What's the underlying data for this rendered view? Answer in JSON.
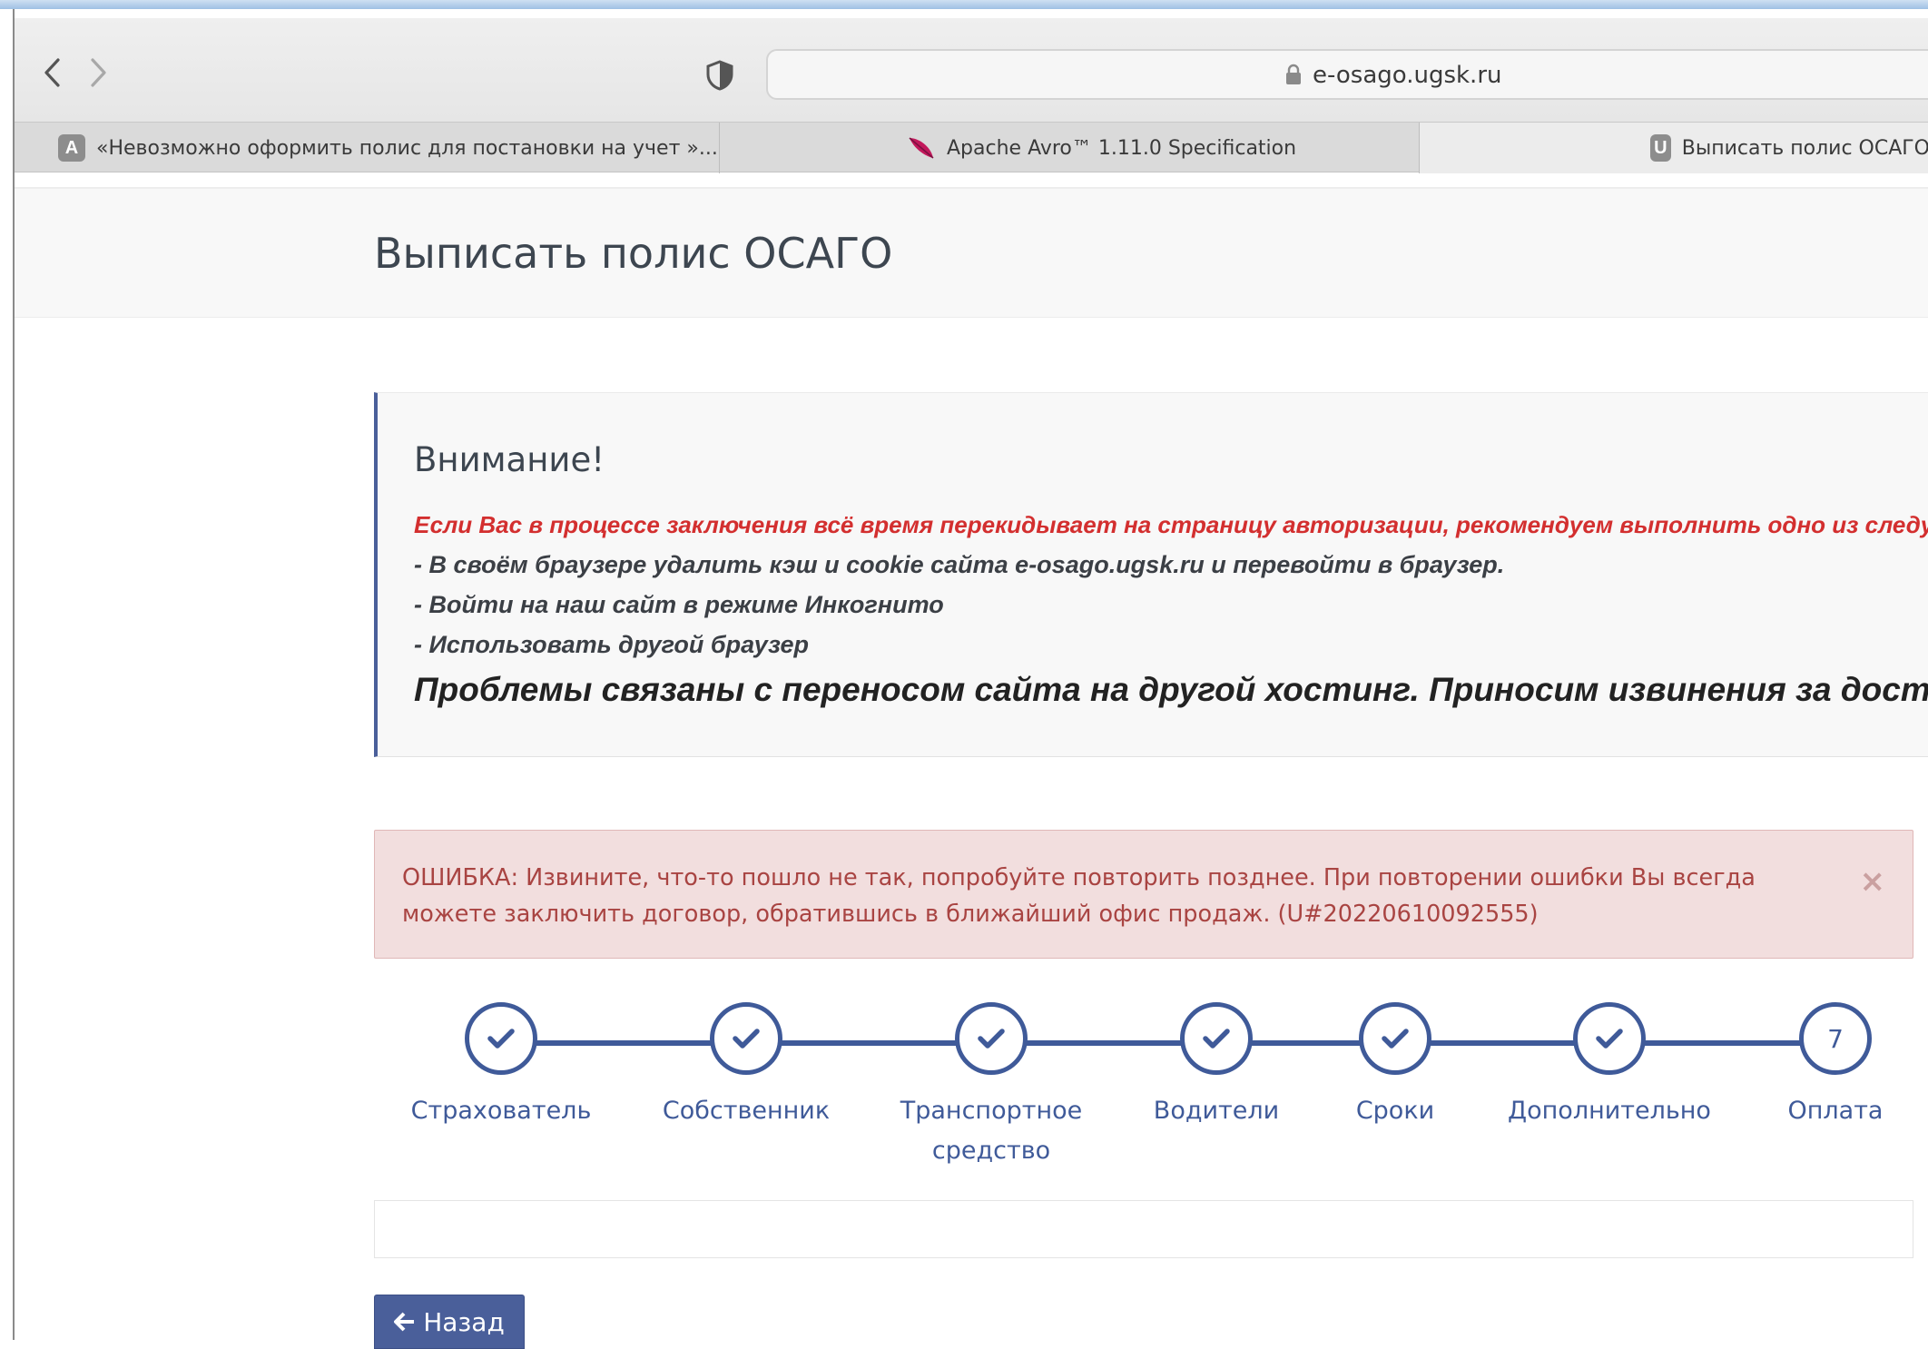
{
  "browser": {
    "url": "e-osago.ugsk.ru",
    "tabs": [
      {
        "favicon": "A",
        "title": "«Невозможно оформить полис для постановки на учет »..."
      },
      {
        "favicon": "feather-icon",
        "title": "Apache Avro™ 1.11.0 Specification"
      },
      {
        "favicon": "U",
        "title": "Выписать полис ОСАГО"
      }
    ]
  },
  "page": {
    "title": "Выписать полис ОСАГО"
  },
  "notice": {
    "heading": "Внимание!",
    "red_line": "Если Вас в процессе заключения всё время перекидывает на страницу авторизации, рекомендуем выполнить одно из следующ",
    "items": [
      "- В своём браузере удалить кэш и cookie сайта e-osago.ugsk.ru и перевойти в браузер.",
      "- Войти на наш сайт в режиме Инкогнито",
      "- Использовать другой браузер"
    ],
    "big_line": "Проблемы связаны с переносом сайта на другой хостинг. Приносим извинения за доставлен"
  },
  "error": {
    "text": "ОШИБКА: Извините, что-то пошло не так, попробуйте повторить позднее. При повторении ошибки Вы всегда можете заключить договор, обратившись в ближайший офис продаж. (U#20220610092555)",
    "close": "×"
  },
  "steps": [
    {
      "label": "Страхователь",
      "state": "done"
    },
    {
      "label": "Собственник",
      "state": "done"
    },
    {
      "label": "Транспортное средство",
      "state": "done"
    },
    {
      "label": "Водители",
      "state": "done"
    },
    {
      "label": "Сроки",
      "state": "done"
    },
    {
      "label": "Дополнительно",
      "state": "done"
    },
    {
      "label": "Оплата",
      "state": "current",
      "number": "7"
    }
  ],
  "buttons": {
    "back": "Назад"
  },
  "colors": {
    "accent": "#3f5a99",
    "error_text": "#a94442",
    "error_bg": "#f2dede",
    "warning_red": "#d32f2f"
  }
}
